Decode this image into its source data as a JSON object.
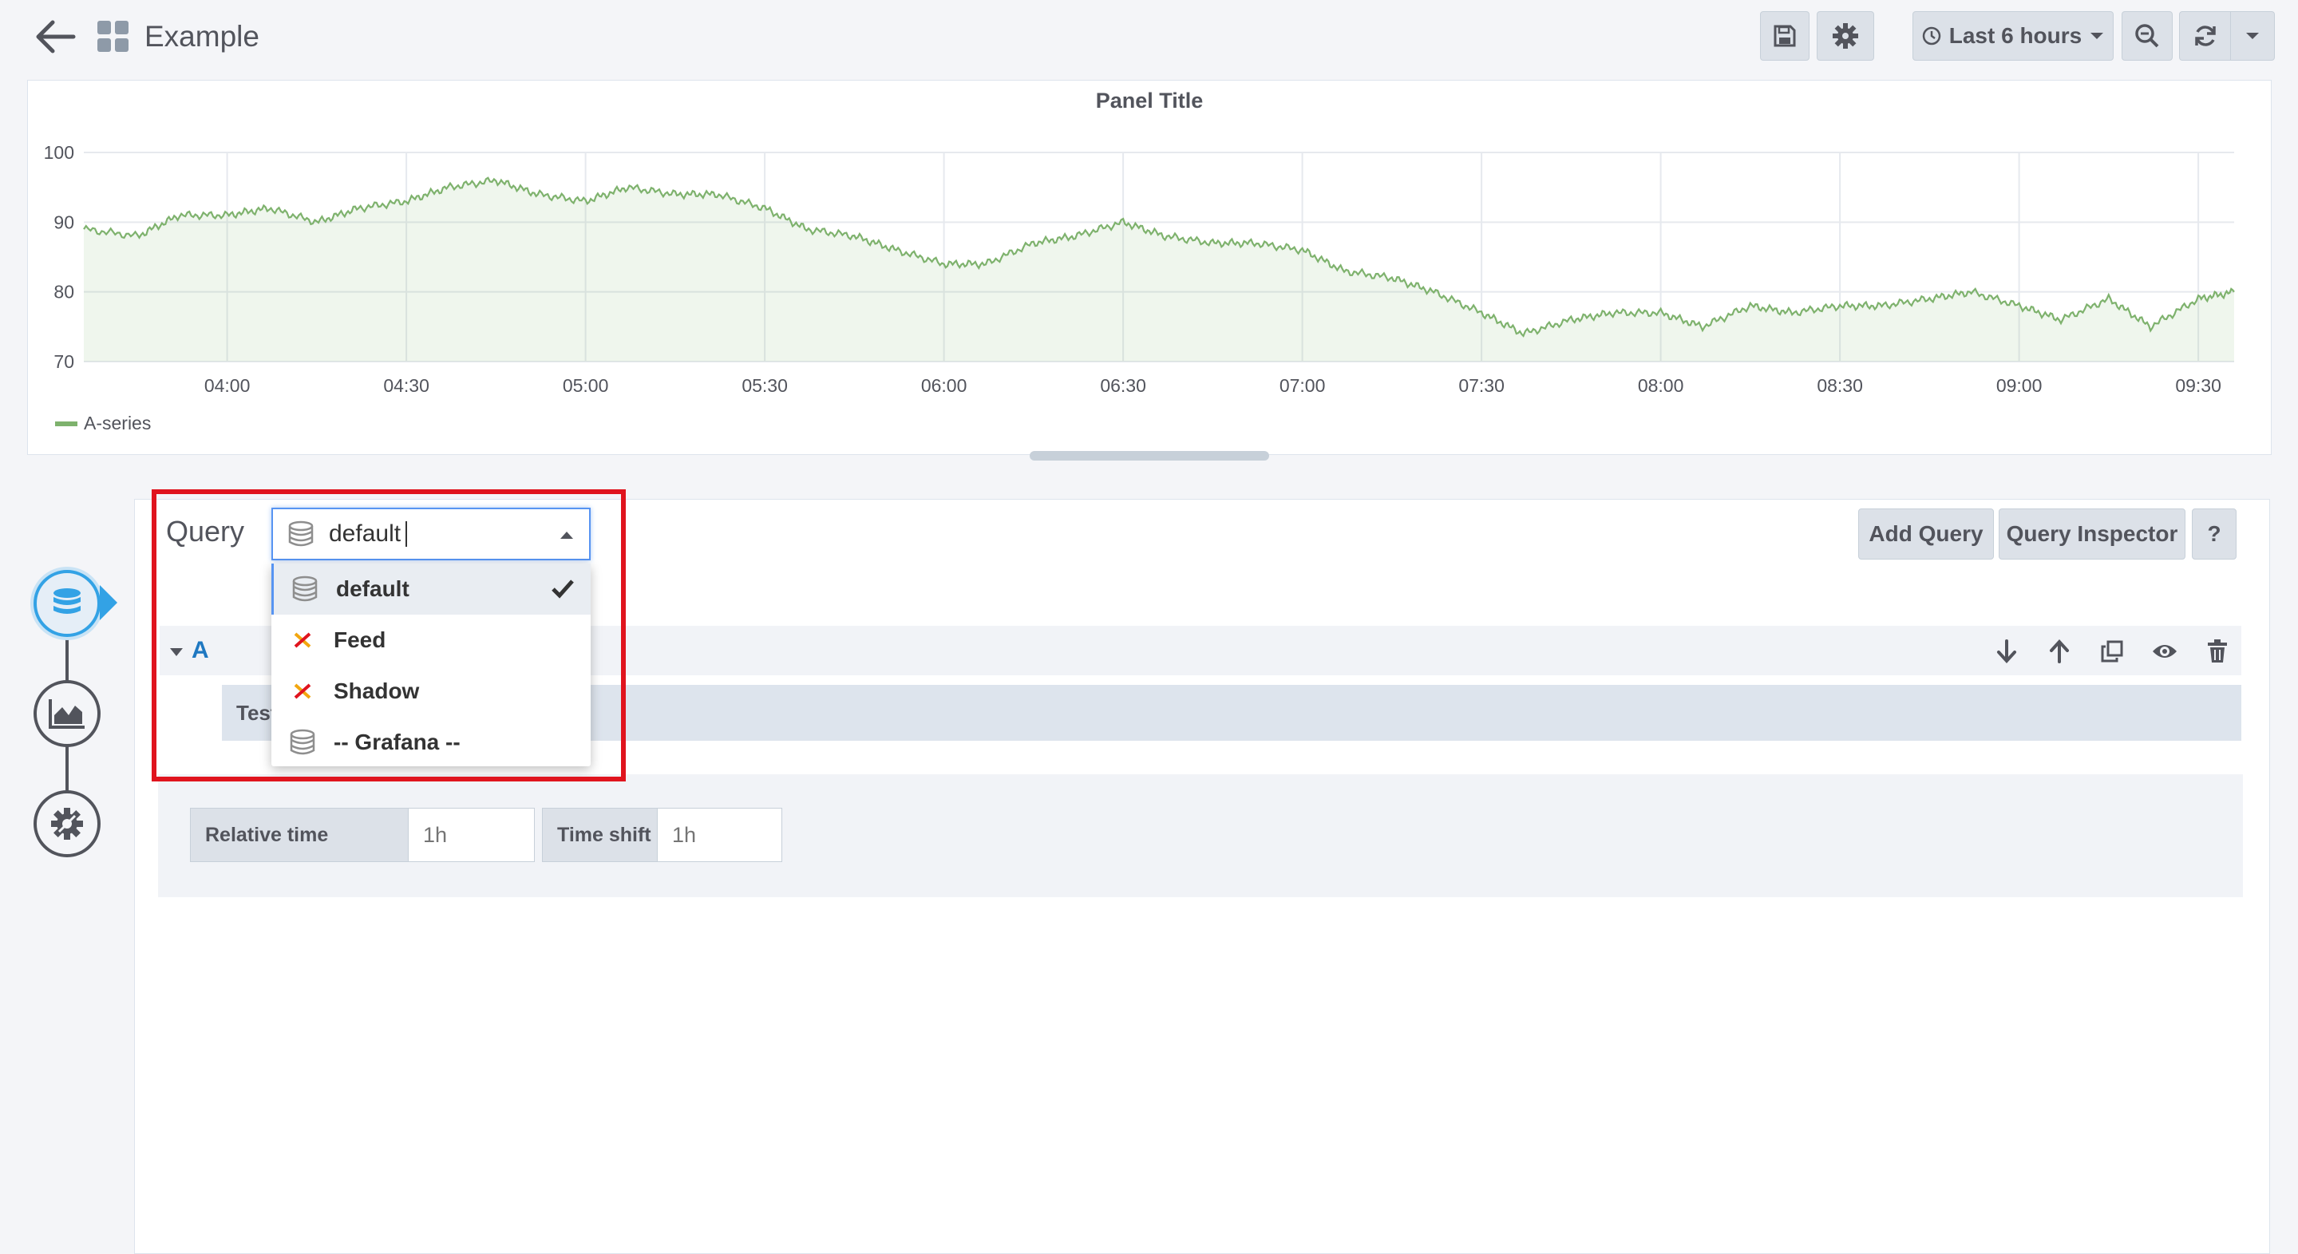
{
  "header": {
    "title": "Example",
    "time_range_label": "Last 6 hours"
  },
  "panel": {
    "title": "Panel Title",
    "legend_label": "A-series"
  },
  "chart_data": {
    "type": "line",
    "title": "Panel Title",
    "xlabel": "",
    "ylabel": "",
    "ylim": [
      70,
      100
    ],
    "yticks": [
      "100",
      "90",
      "80",
      "70"
    ],
    "xticks": [
      "04:00",
      "04:30",
      "05:00",
      "05:30",
      "06:00",
      "06:30",
      "07:00",
      "07:30",
      "08:00",
      "08:30",
      "09:00",
      "09:30"
    ],
    "grid": true,
    "legend_position": "bottom-left",
    "series": [
      {
        "name": "A-series",
        "color": "#7eb26d",
        "x": [
          "03:36",
          "03:45",
          "03:52",
          "04:00",
          "04:07",
          "04:15",
          "04:22",
          "04:30",
          "04:37",
          "04:45",
          "04:52",
          "05:00",
          "05:07",
          "05:15",
          "05:22",
          "05:30",
          "05:37",
          "05:45",
          "05:52",
          "06:00",
          "06:07",
          "06:15",
          "06:22",
          "06:30",
          "06:37",
          "06:45",
          "06:52",
          "07:00",
          "07:07",
          "07:15",
          "07:22",
          "07:30",
          "07:37",
          "07:45",
          "07:52",
          "08:00",
          "08:07",
          "08:15",
          "08:22",
          "08:30",
          "08:37",
          "08:45",
          "08:52",
          "09:00",
          "09:07",
          "09:15",
          "09:22",
          "09:30",
          "09:36"
        ],
        "values": [
          89,
          88,
          91,
          91,
          92,
          90,
          92,
          93,
          95,
          96,
          94,
          93,
          95,
          94,
          94,
          92,
          89,
          88,
          86,
          84,
          84,
          87,
          88,
          90,
          88,
          87,
          87,
          86,
          83,
          82,
          80,
          77,
          74,
          76,
          77,
          77,
          75,
          78,
          77,
          78,
          78,
          79,
          80,
          78,
          76,
          79,
          75,
          79,
          80
        ]
      }
    ]
  },
  "editor": {
    "query_label": "Query",
    "datasource_value": "default",
    "add_query_label": "Add Query",
    "query_inspector_label": "Query Inspector",
    "help_label": "?",
    "query_ref": "A",
    "scenario_label": "Test",
    "relative_time_label": "Relative time",
    "relative_time_placeholder": "1h",
    "time_shift_label": "Time shift",
    "time_shift_placeholder": "1h"
  },
  "datasource_dropdown": {
    "options": [
      {
        "label": "default",
        "icon": "database-icon",
        "selected": true
      },
      {
        "label": "Feed",
        "icon": "cross-x-icon",
        "selected": false
      },
      {
        "label": "Shadow",
        "icon": "cross-x-icon",
        "selected": false
      },
      {
        "label": "-- Grafana --",
        "icon": "database-icon",
        "selected": false
      }
    ]
  },
  "colors": {
    "accent": "#33a2e5",
    "series": "#7eb26d",
    "highlight": "#e0141e"
  }
}
